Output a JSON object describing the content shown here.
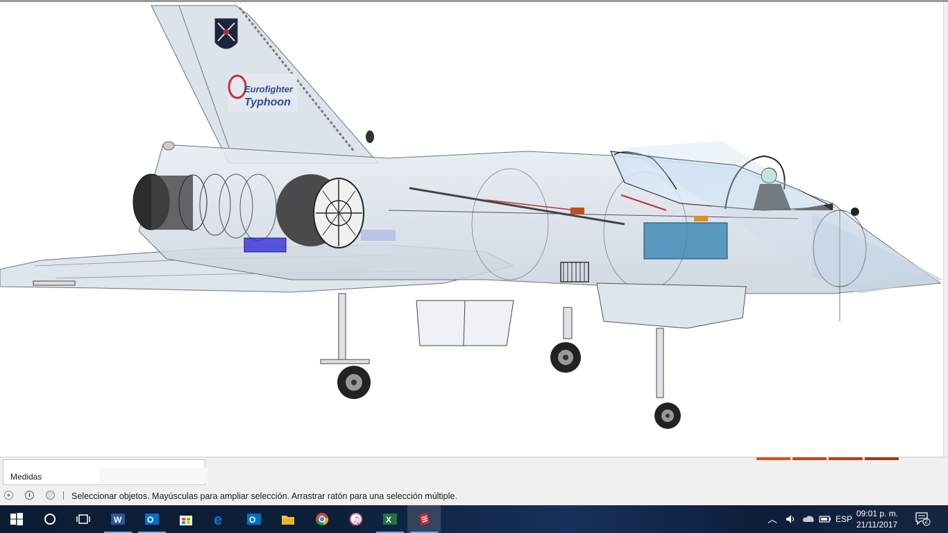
{
  "viewport": {
    "tail_logo_line1": "Eurofighter",
    "tail_logo_line2": "Typhoon"
  },
  "measurements": {
    "label": "Medidas",
    "value": ""
  },
  "status_bar": {
    "hint": "Seleccionar objetos. Mayúsculas para ampliar selección. Arrastrar ratón para una selección múltiple.",
    "icons": [
      "geo-location-icon",
      "info-icon",
      "user-account-icon"
    ]
  },
  "taskbar": {
    "apps": [
      {
        "name": "start-icon"
      },
      {
        "name": "cortana-search-icon"
      },
      {
        "name": "task-view-icon"
      },
      {
        "name": "word-icon",
        "letter": "W",
        "color": "#2b579a"
      },
      {
        "name": "outlook-icon",
        "letter": "O",
        "color": "#0072c6"
      },
      {
        "name": "store-icon"
      },
      {
        "name": "edge-icon",
        "letter": "e",
        "color": "#0a78d7"
      },
      {
        "name": "outlook-icon-2",
        "letter": "O",
        "color": "#0072c6"
      },
      {
        "name": "file-explorer-icon"
      },
      {
        "name": "chrome-icon"
      },
      {
        "name": "itunes-icon"
      },
      {
        "name": "excel-icon",
        "letter": "X",
        "color": "#217346"
      },
      {
        "name": "sketchup-icon"
      }
    ],
    "tray": {
      "language": "ESP",
      "time": "09:01 p. m.",
      "date": "21/11/2017",
      "notifications": "2"
    }
  },
  "colors": {
    "accent_orange": [
      "#d9531e",
      "#c4491a",
      "#b8401a",
      "#a23818"
    ],
    "sketchup_red": "#d4252a",
    "taskbar_active": "#7aa9e6"
  }
}
